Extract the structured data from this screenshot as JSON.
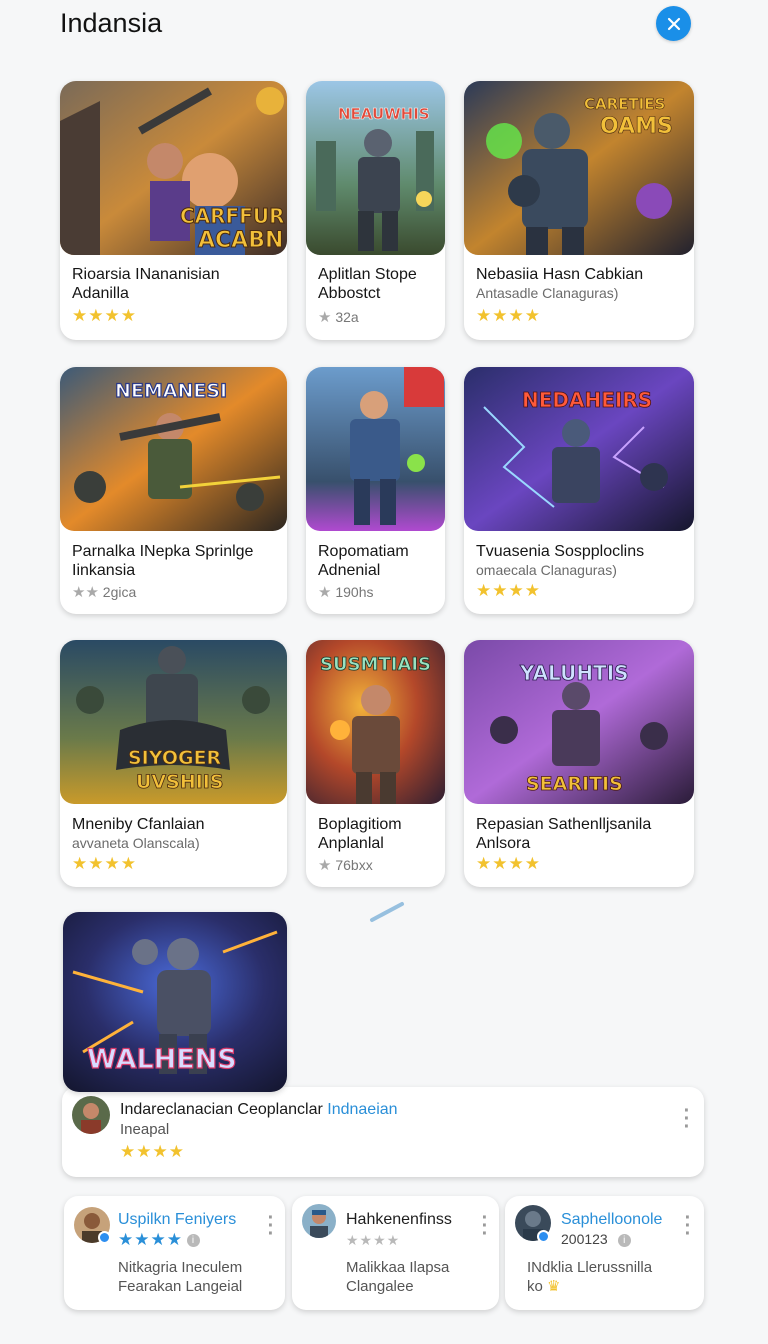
{
  "header": {
    "title": "Indansia",
    "close_icon": "close-icon"
  },
  "colors": {
    "accent": "#1a8fe8",
    "star": "#f2c22e",
    "link": "#2a8fd8"
  },
  "apps": [
    {
      "title": "Rioarsia INananisian",
      "subtitle": "Adanilla",
      "rating_stars": 4,
      "art_text": "CARFFUR ACABN"
    },
    {
      "title": "Aplitlan Stope",
      "subtitle": "Abbostct",
      "meta": "32a",
      "art_text": "NEAUWHIS"
    },
    {
      "title": "Nebasiia Hasn Cabkian",
      "subtitle": "Antasadle Clanaguras)",
      "rating_stars": 4,
      "art_text": "CARETIES OAMS"
    },
    {
      "title": "Parnalka INepka Sprinlge",
      "subtitle": "Iinkansia",
      "meta": "2gica",
      "art_text": "NEMANESI"
    },
    {
      "title": "Ropomatiam",
      "subtitle": "Adnenial",
      "meta": "190hs",
      "art_text": ""
    },
    {
      "title": "Tvuasenia Sospploclins",
      "subtitle": "omaecala Clanaguras)",
      "rating_stars": 4,
      "art_text": "NEDAHEIRS"
    },
    {
      "title": "Mneniby Cfanlaian",
      "subtitle": "avvaneta Olanscala)",
      "rating_stars": 4,
      "art_text": "SIYOGER UVSHIIS"
    },
    {
      "title": "Boplagitiom",
      "subtitle": "Anplanlal",
      "meta": "76bxx",
      "art_text": "SUSMTIAIS"
    },
    {
      "title": "Repasian Sathenlljsanila",
      "subtitle": "Anlsora",
      "rating_stars": 4,
      "art_text": "YALUHTIS SEARITIS"
    },
    {
      "art_text": "WALHENS"
    }
  ],
  "featured": {
    "title": "Indareclanacian Ceoplanclar",
    "tag": "Indnaeian",
    "subtitle": "Ineapal",
    "rating_stars": 4
  },
  "reviews": [
    {
      "name": "Uspilkn Feniyers",
      "rating_stars": 4,
      "line1": "Nitkagria Ineculem",
      "line2": "Fearakan Langeial"
    },
    {
      "name": "Hahkenenfinss",
      "rating_stars": 0,
      "line1": "Malikkaa Ilapsa",
      "line2": "Clangalee"
    },
    {
      "name": "Saphelloonole",
      "date": "200123",
      "line1": "INdklia Llerussnilla",
      "line2": "ko"
    }
  ]
}
